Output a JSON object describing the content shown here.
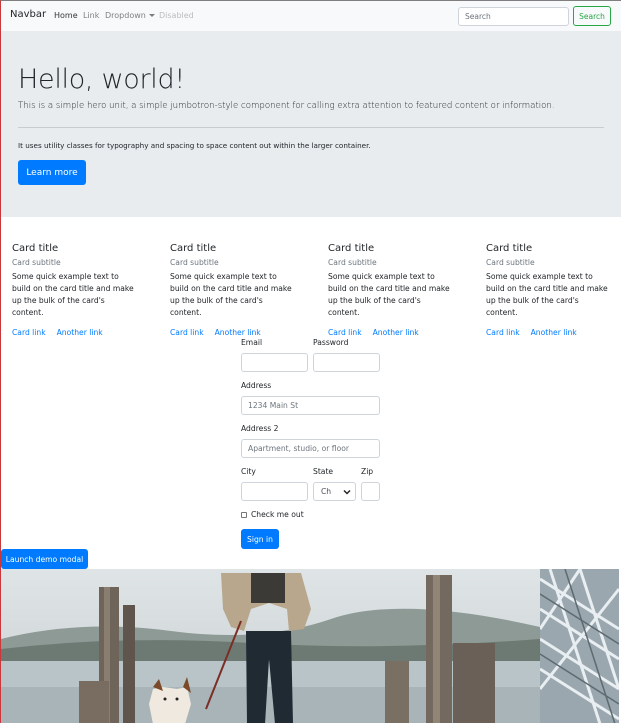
{
  "navbar": {
    "brand": "Navbar",
    "links": [
      "Home",
      "Link",
      "Dropdown",
      "Disabled"
    ],
    "search_placeholder": "Search",
    "search_button": "Search"
  },
  "jumbotron": {
    "title": "Hello, world!",
    "lead": "This is a simple hero unit, a simple jumbotron-style component for calling extra attention to featured content or information.",
    "text": "It uses utility classes for typography and spacing to space content out within the larger container.",
    "button": "Learn more"
  },
  "cards": [
    {
      "title": "Card title",
      "subtitle": "Card subtitle",
      "text": "Some quick example text to build on the card title and make up the bulk of the card's content.",
      "link1": "Card link",
      "link2": "Another link"
    },
    {
      "title": "Card title",
      "subtitle": "Card subtitle",
      "text": "Some quick example text to build on the card title and make up the bulk of the card's content.",
      "link1": "Card link",
      "link2": "Another link"
    },
    {
      "title": "Card title",
      "subtitle": "Card subtitle",
      "text": "Some quick example text to build on the card title and make up the bulk of the card's content.",
      "link1": "Card link",
      "link2": "Another link"
    },
    {
      "title": "Card title",
      "subtitle": "Card subtitle",
      "text": "Some quick example text to build on the card title and make up the bulk of the card's content.",
      "link1": "Card link",
      "link2": "Another link"
    }
  ],
  "form": {
    "email_label": "Email",
    "password_label": "Password",
    "address_label": "Address",
    "address_placeholder": "1234 Main St",
    "address2_label": "Address 2",
    "address2_placeholder": "Apartment, studio, or floor",
    "city_label": "City",
    "state_label": "State",
    "state_value": "Ch",
    "zip_label": "Zip",
    "check_label": "Check me out",
    "submit": "Sign in"
  },
  "modal_button": "Launch demo modal",
  "colors": {
    "primary": "#007bff",
    "success": "#28a745",
    "jumbotron_bg": "#e9ecef",
    "navbar_bg": "#f8f9fa"
  }
}
